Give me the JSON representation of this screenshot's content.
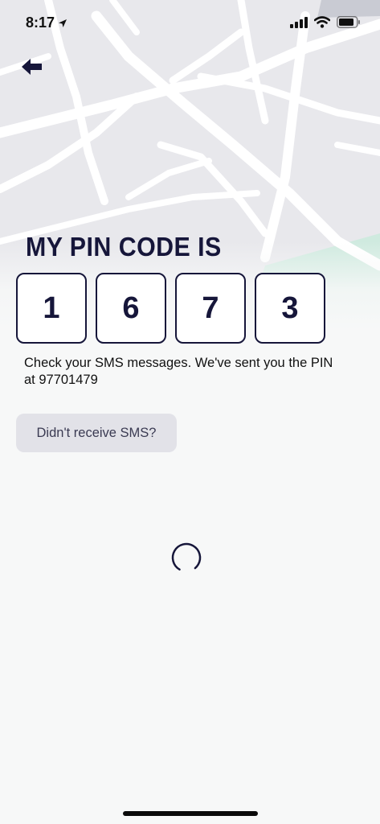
{
  "status_bar": {
    "time": "8:17"
  },
  "header": {
    "back_icon": "arrow-left-icon"
  },
  "main": {
    "title": "MY PIN CODE IS",
    "pin_digits": [
      "1",
      "6",
      "7",
      "3"
    ],
    "message_line1": "Check your SMS messages. We've sent you the PIN",
    "message_line2": "at 97701479",
    "resend_label": "Didn't receive SMS?"
  },
  "colors": {
    "accent": "#16163a",
    "map_road": "#ffffff",
    "map_land": "#e8e8ec",
    "map_park": "#cfeadf"
  }
}
